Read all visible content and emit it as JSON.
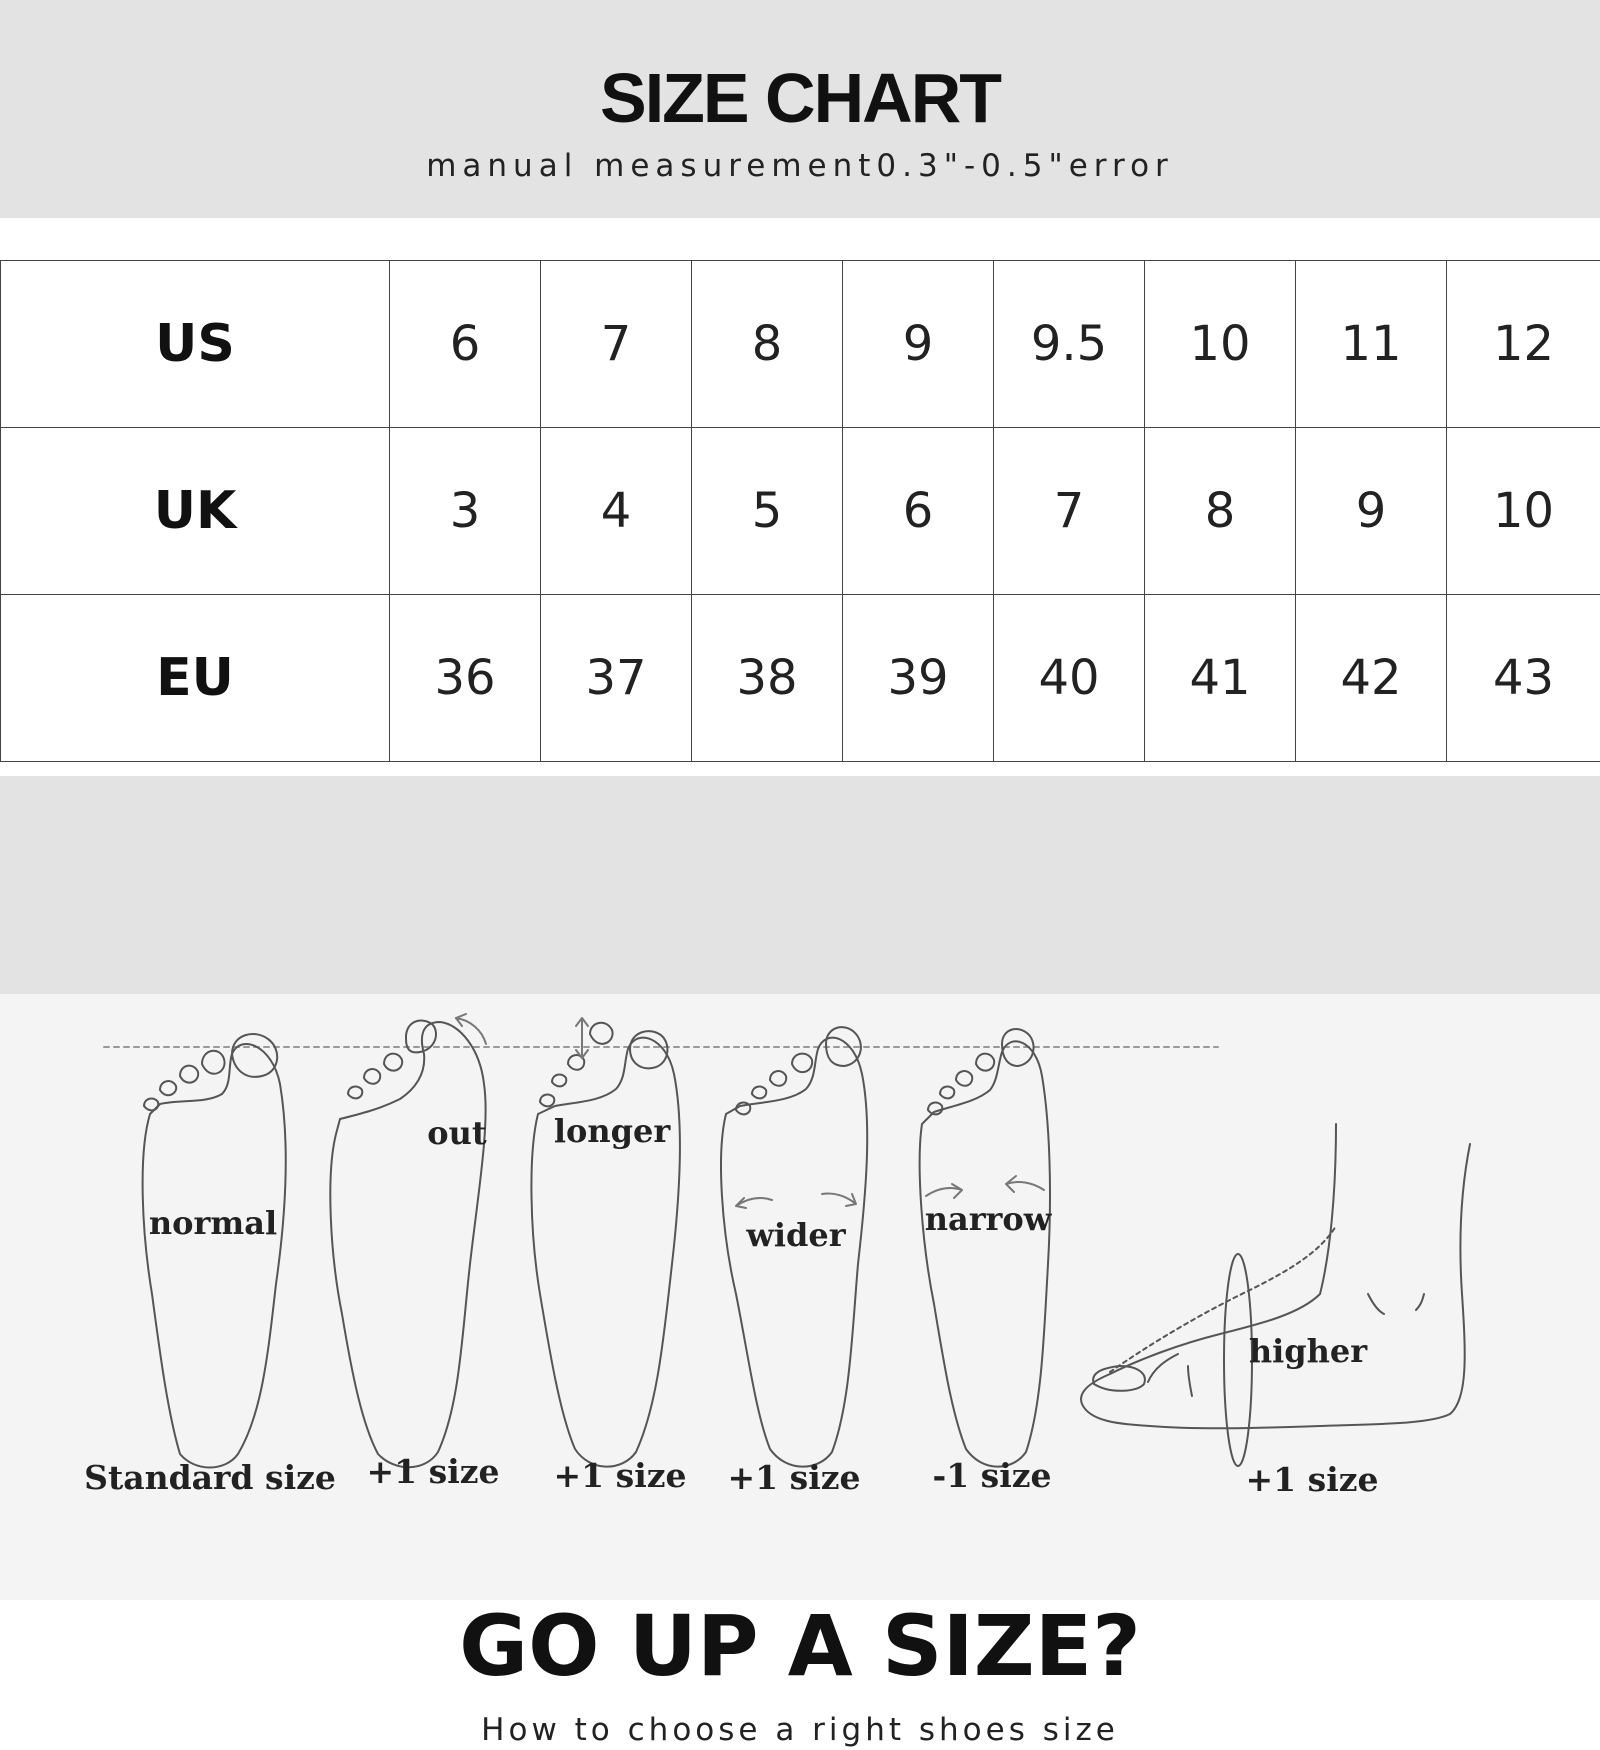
{
  "header": {
    "title": "SIZE CHART",
    "subtitle": "manual measurement0.3\"-0.5\"error"
  },
  "size_table": {
    "rows": [
      {
        "label": "US",
        "values": [
          "6",
          "7",
          "8",
          "9",
          "9.5",
          "10",
          "11",
          "12"
        ]
      },
      {
        "label": "UK",
        "values": [
          "3",
          "4",
          "5",
          "6",
          "7",
          "8",
          "9",
          "10"
        ]
      },
      {
        "label": "EU",
        "values": [
          "36",
          "37",
          "38",
          "39",
          "40",
          "41",
          "42",
          "43"
        ]
      }
    ]
  },
  "guide": {
    "title": "GO UP A SIZE?",
    "subtitle": "How to choose a right shoes size",
    "feet": [
      {
        "label": "normal",
        "size_advice": "Standard size",
        "icon": "foot-normal-icon"
      },
      {
        "label": "out",
        "size_advice": "+1 size",
        "icon": "foot-out-icon"
      },
      {
        "label": "longer",
        "size_advice": "+1 size",
        "icon": "foot-longer-icon"
      },
      {
        "label": "wider",
        "size_advice": "+1 size",
        "icon": "foot-wider-icon"
      },
      {
        "label": "narrow",
        "size_advice": "-1 size",
        "icon": "foot-narrow-icon"
      },
      {
        "label": "higher",
        "size_advice": "+1 size",
        "icon": "foot-higher-icon"
      }
    ]
  }
}
